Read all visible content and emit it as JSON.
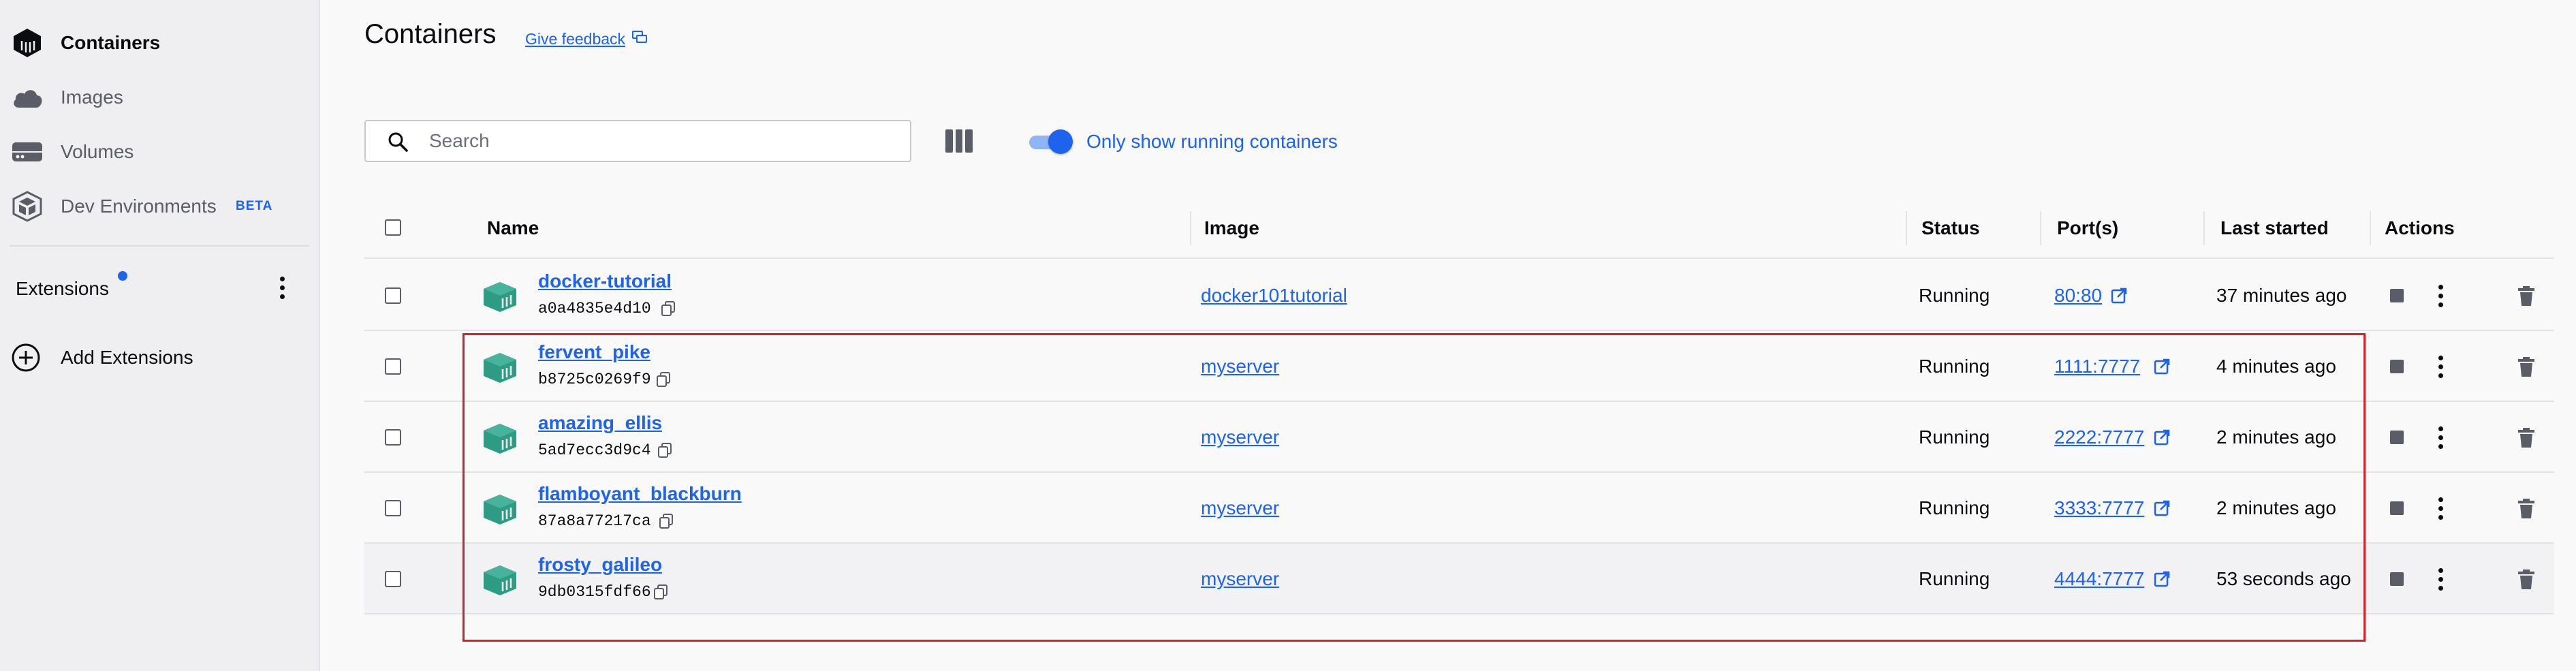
{
  "sidebar": {
    "items": [
      {
        "label": "Containers",
        "icon": "containers-icon",
        "active": true
      },
      {
        "label": "Images",
        "icon": "cloud-icon",
        "active": false
      },
      {
        "label": "Volumes",
        "icon": "volume-drive-icon",
        "active": false
      },
      {
        "label": "Dev Environments",
        "icon": "dev-environments-icon",
        "active": false,
        "badge": "BETA"
      }
    ],
    "extensions_label": "Extensions",
    "add_extensions_label": "Add Extensions"
  },
  "header": {
    "title": "Containers",
    "feedback_label": "Give feedback"
  },
  "toolbar": {
    "search_placeholder": "Search",
    "toggle_label": "Only show running containers",
    "toggle_on": true
  },
  "table": {
    "columns": {
      "name": "Name",
      "image": "Image",
      "status": "Status",
      "ports": "Port(s)",
      "last_started": "Last started",
      "actions": "Actions"
    },
    "rows": [
      {
        "name": "docker-tutorial",
        "id": "a0a4835e4d10",
        "image": "docker101tutorial",
        "status": "Running",
        "port": "80:80",
        "last_started": "37 minutes ago"
      },
      {
        "name": "fervent_pike",
        "id": "b8725c0269f9",
        "image": "myserver",
        "status": "Running",
        "port": "1111:7777",
        "last_started": "4 minutes ago"
      },
      {
        "name": "amazing_ellis",
        "id": "5ad7ecc3d9c4",
        "image": "myserver",
        "status": "Running",
        "port": "2222:7777",
        "last_started": "2 minutes ago"
      },
      {
        "name": "flamboyant_blackburn",
        "id": "87a8a77217ca",
        "image": "myserver",
        "status": "Running",
        "port": "3333:7777",
        "last_started": "2 minutes ago"
      },
      {
        "name": "frosty_galileo",
        "id": "9db0315fdf66",
        "image": "myserver",
        "status": "Running",
        "port": "4444:7777",
        "last_started": "53 seconds ago"
      }
    ]
  },
  "colors": {
    "accent": "#1d63ed",
    "container_icon": "#2e9c85",
    "selection_outline": "#d3202b"
  }
}
